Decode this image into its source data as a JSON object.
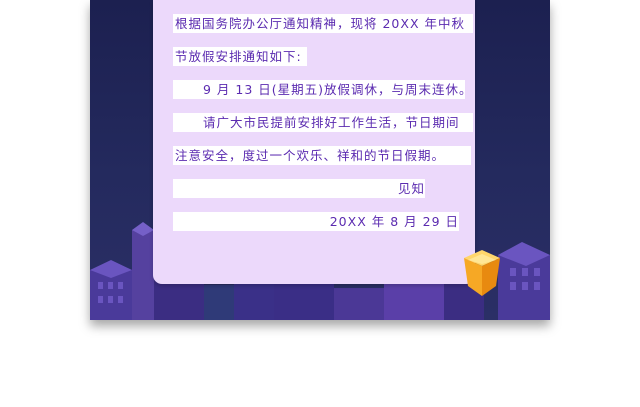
{
  "notice": {
    "lines": [
      "根据国务院办公厅通知精神，现将 20XX 年中秋",
      "节放假安排通知如下:",
      "9 月 13 日(星期五)放假调休，与周末连休。",
      "请广大市民提前安排好工作生活，节日期间",
      "注意安全，度过一个欢乐、祥和的节日假期。",
      "见知",
      "20XX 年 8 月 29 日"
    ]
  },
  "colors": {
    "background": "#1c2050",
    "card": "#ecd9fb",
    "text": "#5b2bb0",
    "building": "#5a3fa8",
    "lantern": "#f6a825"
  }
}
